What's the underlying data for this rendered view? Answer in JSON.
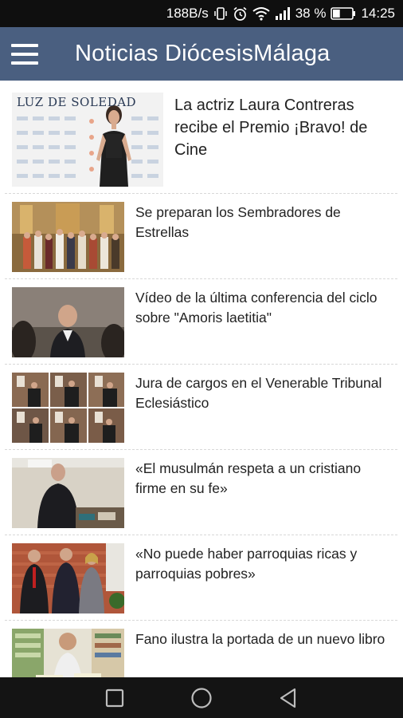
{
  "status_bar": {
    "net_speed": "188B/s",
    "battery_percent": "38 %",
    "time": "14:25",
    "icons": [
      "vibrate-icon",
      "alarm-icon",
      "wifi-icon",
      "signal-icon",
      "battery-icon"
    ],
    "battery_level": 0.38
  },
  "app_bar": {
    "title": "Noticias DiócesisMálaga",
    "menu_icon": "hamburger-menu-icon",
    "background_color": "#4a5f80"
  },
  "news": [
    {
      "title": "La actriz Laura Contreras recibe el Premio ¡Bravo! de Cine",
      "thumb": "photo-actress-luz-de-soledad",
      "thumb_text": "LUZ DE SOLEDAD"
    },
    {
      "title": "Se preparan los Sembradores de Estrellas",
      "thumb": "photo-children-costumes-church"
    },
    {
      "title": "Vídeo de la última conferencia del ciclo sobre \"Amoris laetitia\"",
      "thumb": "photo-conference-speaker"
    },
    {
      "title": "Jura de cargos en el Venerable Tribunal Eclesiástico",
      "thumb": "photo-collage-oath"
    },
    {
      "title": "«El musulmán respeta a un cristiano firme en su fe»",
      "thumb": "photo-priest-portrait"
    },
    {
      "title": "«No puede haber parroquias ricas y parroquias pobres»",
      "thumb": "photo-three-people"
    },
    {
      "title": "Fano ilustra la portada de un nuevo libro",
      "thumb": "photo-man-bookshelf"
    }
  ],
  "nav_bar": {
    "buttons": [
      "recent-apps-icon",
      "home-icon",
      "back-icon"
    ]
  }
}
